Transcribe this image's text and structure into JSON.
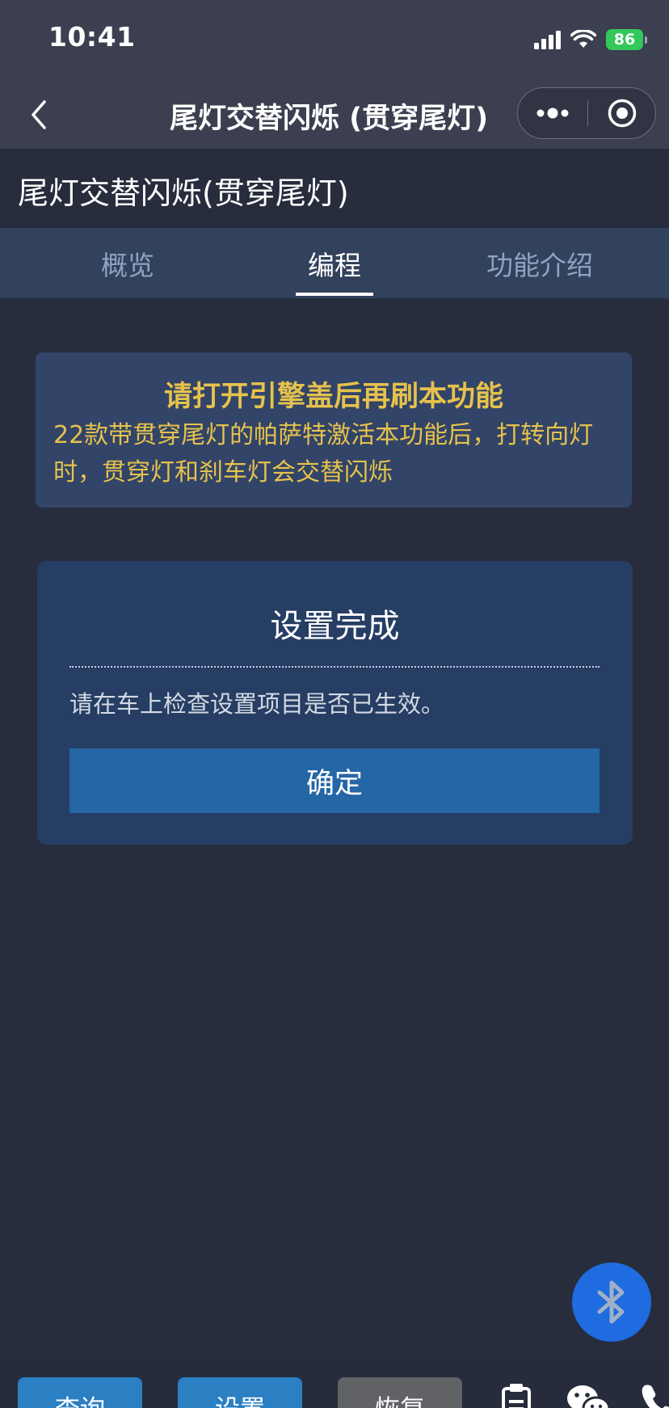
{
  "status_bar": {
    "time": "10:41",
    "battery": "86",
    "icons": [
      "signal-icon",
      "wifi-icon",
      "battery-icon"
    ]
  },
  "nav": {
    "title": "尾灯交替闪烁 (贯穿尾灯)",
    "back_icon": "chevron-left-icon",
    "more_icon": "more-dots-icon",
    "close_icon": "target-circle-icon"
  },
  "page": {
    "title": "尾灯交替闪烁(贯穿尾灯)"
  },
  "tabs": [
    {
      "label": "概览",
      "active": false
    },
    {
      "label": "编程",
      "active": true
    },
    {
      "label": "功能介绍",
      "active": false
    }
  ],
  "notice": {
    "title": "请打开引擎盖后再刷本功能",
    "body": "22款带贯穿尾灯的帕萨特激活本功能后，打转向灯时，贯穿灯和刹车灯会交替闪烁"
  },
  "dialog": {
    "title": "设置完成",
    "message": "请在车上检查设置项目是否已生效。",
    "confirm_label": "确定"
  },
  "fab": {
    "icon": "bluetooth-icon"
  },
  "bottom_bar": {
    "buttons": [
      {
        "label": "查询"
      },
      {
        "label": "设置"
      },
      {
        "label": "恢复"
      }
    ],
    "icons": [
      "clipboard-icon",
      "wechat-icon",
      "phone-icon"
    ]
  },
  "colors": {
    "background": "#272d3d",
    "nav_background": "#3b3f4f",
    "tab_background": "#32415c",
    "notice_text": "#e6c24d",
    "primary_button": "#2566a5",
    "bottom_primary": "#2b7fc3",
    "bottom_disabled": "#606266",
    "bluetooth_fab": "#1f6be0"
  }
}
